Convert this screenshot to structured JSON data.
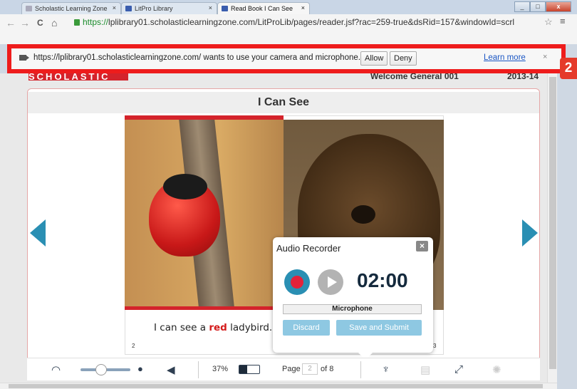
{
  "browser": {
    "tabs": [
      {
        "label": "Scholastic Learning Zone",
        "close": "×"
      },
      {
        "label": "LitPro Library",
        "close": "×"
      },
      {
        "label": "Read Book I Can See",
        "close": "×"
      }
    ],
    "address": {
      "https": "https://",
      "rest": "lplibrary01.scholasticlearningzone.com/LitProLib/pages/reader.jsf?rac=259-true&dsRid=157&windowId=scrl"
    },
    "nav": {
      "back": "←",
      "forward": "→",
      "reload": "C",
      "home": "⌂"
    },
    "star": "☆",
    "menu": "≡",
    "window_buttons": {
      "minimize": "_",
      "maximize": "□",
      "close": "x"
    }
  },
  "permission_bar": {
    "message": "https://lplibrary01.scholasticlearningzone.com/ wants to use your camera and microphone.",
    "allow": "Allow",
    "deny": "Deny",
    "learn_more": "Learn more",
    "close": "×"
  },
  "annotation": {
    "badge": "2"
  },
  "site": {
    "brand": "SCHOLASTIC",
    "welcome": "Welcome General 001",
    "year": "2013-14"
  },
  "reader": {
    "title": "I Can See",
    "caption": {
      "before": "I can see a ",
      "highlight": "red",
      "after": " ladybird."
    },
    "left_page_number": "2",
    "right_page_number": "3"
  },
  "recorder": {
    "title": "Audio Recorder",
    "close": "×",
    "timer": "02:00",
    "input": "Microphone",
    "discard": "Discard",
    "submit": "Save and Submit"
  },
  "bottom_toolbar": {
    "zoom": "37%",
    "page_label": "Page",
    "page_value": "2",
    "page_of": "of 8",
    "battery_level": 0.4
  },
  "colors": {
    "accent": "#2a8fb3",
    "brand": "#d4232b",
    "highlight": "#ee1c1c"
  }
}
